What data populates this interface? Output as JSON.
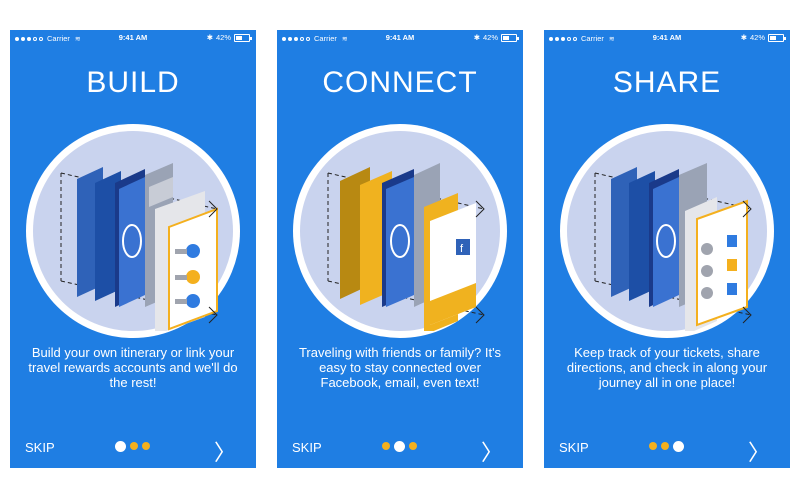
{
  "colors": {
    "accent": "#1f7ee3",
    "pager_active": "#ffffff",
    "pager_inactive": "#f4b01e"
  },
  "screens": [
    {
      "status": {
        "carrier": "Carrier",
        "time": "9:41 AM",
        "battery": "42%"
      },
      "title": "BUILD",
      "description": "Build your own itinerary or link your travel rewards accounts and we'll do the rest!",
      "skip_label": "SKIP",
      "next_icon": "chevron-right-icon",
      "pager": [
        true,
        false,
        false
      ]
    },
    {
      "status": {
        "carrier": "Carrier",
        "time": "9:41 AM",
        "battery": "42%"
      },
      "title": "CONNECT",
      "description": "Traveling with friends or family? It's easy to stay connected over Facebook, email, even text!",
      "skip_label": "SKIP",
      "next_icon": "chevron-right-icon",
      "pager": [
        false,
        true,
        false
      ]
    },
    {
      "status": {
        "carrier": "Carrier",
        "time": "9:41 AM",
        "battery": "42%"
      },
      "title": "SHARE",
      "description": "Keep track of your tickets, share directions, and check in along your journey all in one place!",
      "skip_label": "SKIP",
      "next_icon": "chevron-right-icon",
      "pager": [
        false,
        false,
        true
      ]
    }
  ]
}
